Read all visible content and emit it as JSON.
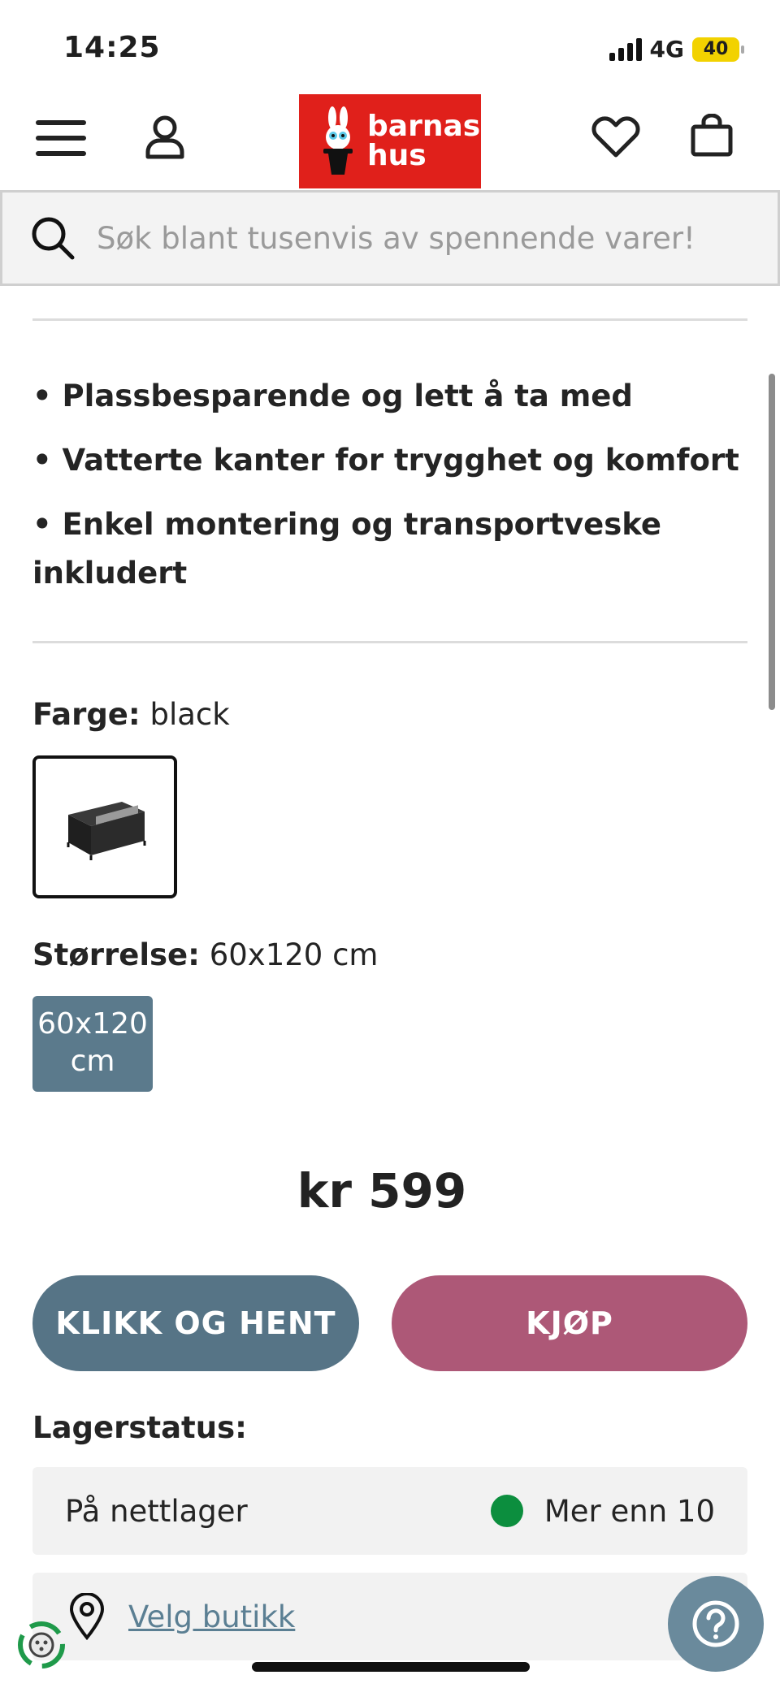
{
  "status_bar": {
    "time": "14:25",
    "network": "4G",
    "battery": "40"
  },
  "header": {
    "logo_line1": "barnas",
    "logo_line2": "hus",
    "menu_icon": "hamburger-icon",
    "account_icon": "user-icon",
    "wishlist_icon": "heart-icon",
    "cart_icon": "shopping-bag-icon",
    "brand_color": "#e0201b"
  },
  "search": {
    "placeholder": "Søk blant tusenvis av spennende varer!"
  },
  "features": [
    "• Plassbesparende og lett å ta med",
    "• Vatterte kanter for trygghet og komfort",
    "• Enkel montering og transportveske inkludert"
  ],
  "options": {
    "color_label": "Farge:",
    "color_value": "black",
    "size_label": "Størrelse:",
    "size_value": "60x120 cm",
    "size_chip": "60x120 cm"
  },
  "price": "kr 599",
  "buttons": {
    "click_collect": "KLIKK OG HENT",
    "buy": "KJØP"
  },
  "stock": {
    "heading": "Lagerstatus:",
    "location": "På nettlager",
    "value": "Mer enn 10",
    "status_color": "#0c8e3e"
  },
  "store": {
    "link": "Velg butikk"
  },
  "colors": {
    "primary": "#567486",
    "buy": "#ad5877",
    "chip": "#5b7a8c"
  }
}
